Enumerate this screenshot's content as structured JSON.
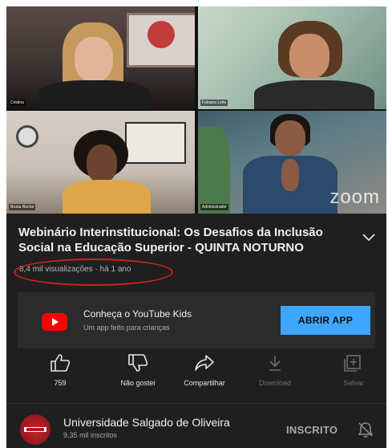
{
  "video": {
    "participants": [
      {
        "name": "Cristina"
      },
      {
        "name": "Fabiana Leite"
      },
      {
        "name": "Bruna Rocha"
      },
      {
        "name": "Administrador"
      }
    ],
    "watermark": "zoom"
  },
  "info": {
    "title": "Webinário Interinstitucional: Os Desafios da Inclusão Social na Educação Superior - QUINTA NOTURNO",
    "views": "8,4 mil visualizações",
    "age": "há 1 ano",
    "separator": " · ",
    "expand_icon": "chevron-down-icon"
  },
  "banner": {
    "title": "Conheça o YouTube Kids",
    "subtitle": "Um app feito para crianças",
    "button": "ABRIR APP",
    "icon": "youtube-logo-icon"
  },
  "actions": [
    {
      "label": "759",
      "icon": "thumbs-up-icon"
    },
    {
      "label": "Não gostei",
      "icon": "thumbs-down-icon"
    },
    {
      "label": "Compartilhar",
      "icon": "share-icon"
    },
    {
      "label": "Download",
      "icon": "download-icon"
    },
    {
      "label": "Salvar",
      "icon": "save-icon"
    }
  ],
  "channel": {
    "name": "Universidade Salgado de Oliveira",
    "subscribers": "9,35 mil inscritos",
    "subscribe_state": "INSCRITO",
    "notification_icon": "bell-off-icon"
  },
  "colors": {
    "background": "#1f1f1f",
    "accent_button": "#3ea6ff",
    "highlight_circle": "#d0201c",
    "youtube_red": "#ff0000"
  }
}
